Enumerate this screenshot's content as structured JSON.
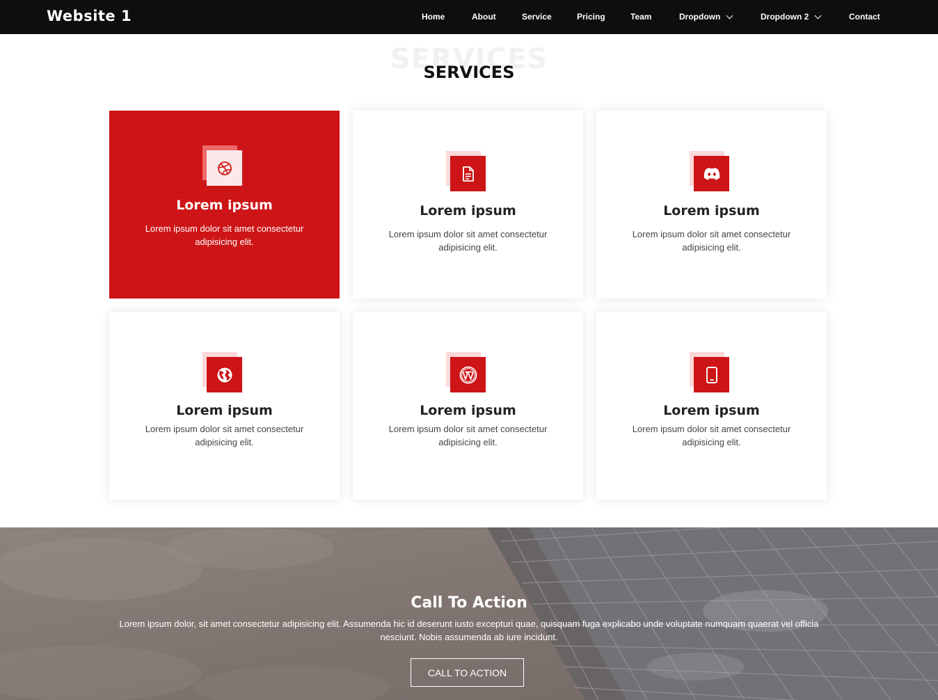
{
  "header": {
    "brand": "Website 1",
    "nav": [
      {
        "label": "Home"
      },
      {
        "label": "About"
      },
      {
        "label": "Service"
      },
      {
        "label": "Pricing"
      },
      {
        "label": "Team"
      },
      {
        "label": "Dropdown"
      },
      {
        "label": "Dropdown 2"
      },
      {
        "label": "Contact"
      }
    ]
  },
  "services": {
    "bg_title": "SERVICES",
    "title": "SERVICES",
    "cards": [
      {
        "icon": "dribbble-icon",
        "title": "Lorem ipsum",
        "desc": "Lorem ipsum dolor sit amet consectetur adipisicing elit."
      },
      {
        "icon": "document-icon",
        "title": "Lorem ipsum",
        "desc": "Lorem ipsum dolor sit amet consectetur adipisicing elit."
      },
      {
        "icon": "discord-icon",
        "title": "Lorem ipsum",
        "desc": "Lorem ipsum dolor sit amet consectetur adipisicing elit."
      },
      {
        "icon": "globe-icon",
        "title": "Lorem ipsum",
        "desc": "Lorem ipsum dolor sit amet consectetur adipisicing elit."
      },
      {
        "icon": "wordpress-icon",
        "title": "Lorem ipsum",
        "desc": "Lorem ipsum dolor sit amet consectetur adipisicing elit."
      },
      {
        "icon": "tablet-icon",
        "title": "Lorem ipsum",
        "desc": "Lorem ipsum dolor sit amet consectetur adipisicing elit."
      }
    ]
  },
  "cta": {
    "title": "Call To Action",
    "text": "Lorem ipsum dolor, sit amet consectetur adipisicing elit. Assumenda hic id deserunt iusto excepturi quae, quisquam fuga explicabo unde voluptate numquam quaerat vel officia nesciunt. Nobis assumenda ab iure incidunt.",
    "button": "CALL TO ACTION"
  },
  "colors": {
    "accent": "#cd1416",
    "header_bg": "#0e0e0e"
  }
}
